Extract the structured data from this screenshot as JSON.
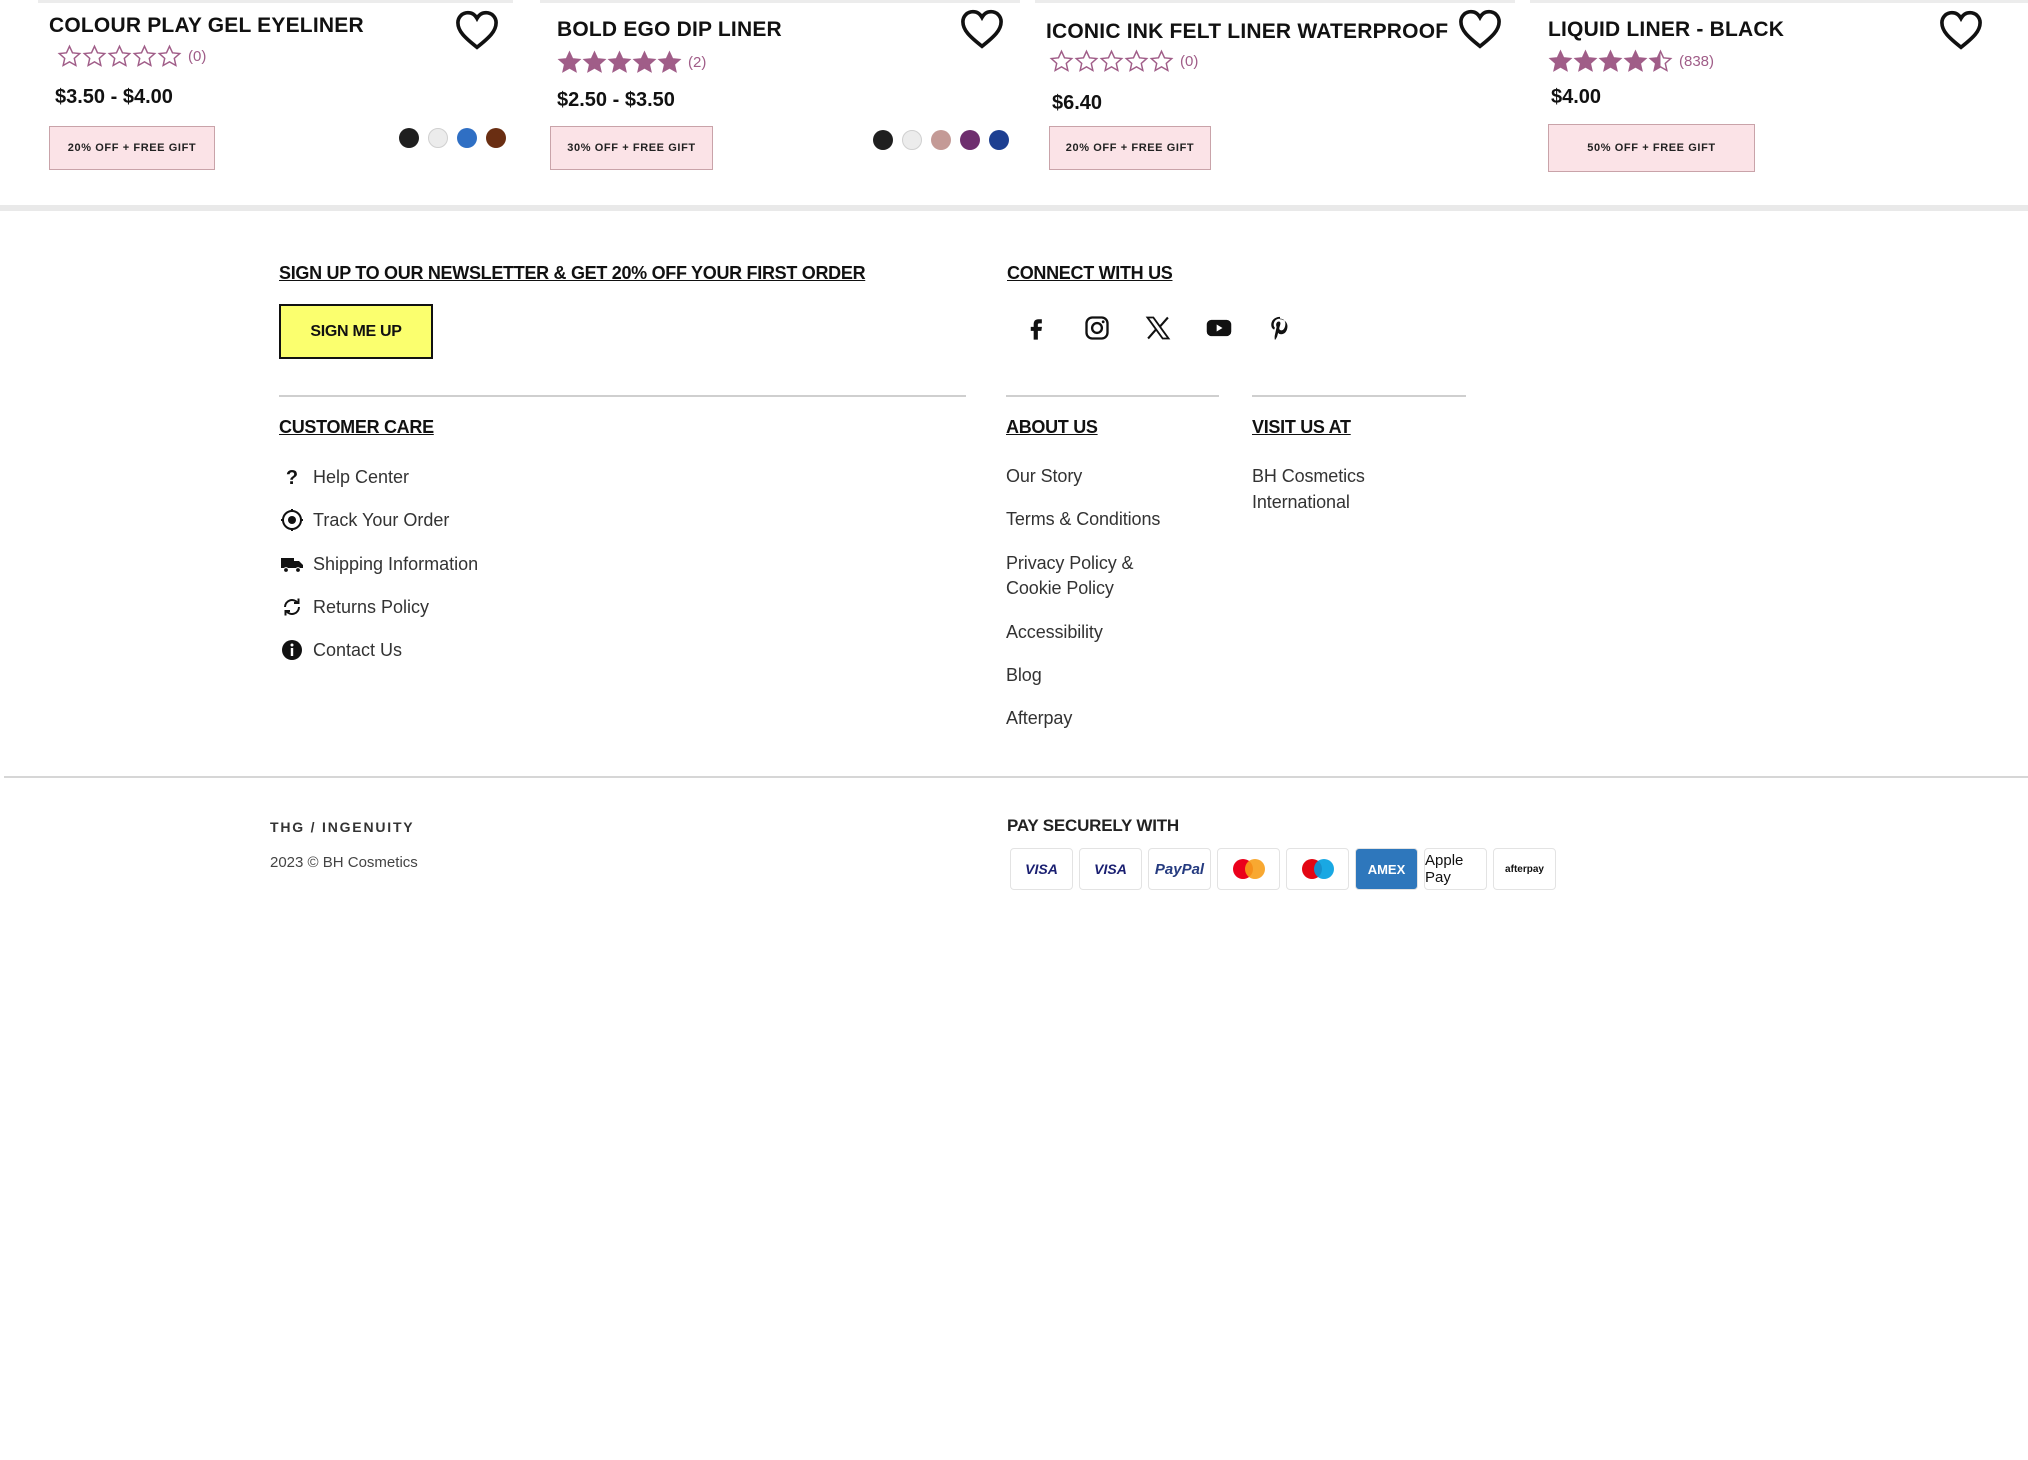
{
  "products": [
    {
      "name": "COLOUR PLAY GEL EYELINER",
      "rating": 0,
      "rating_count": "(0)",
      "price": "$3.50 - $4.00",
      "promo": "20% OFF + FREE GIFT",
      "swatches": [
        "#1f1f1f",
        "#ececec",
        "#2f6fc4",
        "#6a2e12"
      ]
    },
    {
      "name": "BOLD EGO DIP LINER",
      "rating": 5,
      "rating_count": "(2)",
      "price": "$2.50 - $3.50",
      "promo": "30% OFF + FREE GIFT",
      "swatches": [
        "#1f1f1f",
        "#ececec",
        "#c49a96",
        "#6e2e6e",
        "#1d3f91"
      ]
    },
    {
      "name": "ICONIC  INK FELT LINER WATERPROOF",
      "rating": 0,
      "rating_count": "(0)",
      "price": "$6.40",
      "promo": "20% OFF + FREE GIFT",
      "swatches": []
    },
    {
      "name": "LIQUID LINER  - BLACK",
      "rating": 4.5,
      "rating_count": "(838)",
      "price": "$4.00",
      "promo": "50% OFF + FREE GIFT",
      "swatches": []
    }
  ],
  "colors": {
    "star": "#a05d88",
    "promo_bg": "#fbe3e7",
    "signup_bg": "#fbff6e"
  },
  "newsletter": {
    "heading": "SIGN UP TO OUR NEWSLETTER & GET 20% OFF YOUR FIRST ORDER",
    "button": "SIGN ME UP"
  },
  "connect": {
    "heading": "CONNECT WITH US",
    "icons": [
      "facebook-icon",
      "instagram-icon",
      "x-icon",
      "youtube-icon",
      "pinterest-icon"
    ]
  },
  "customer_care": {
    "heading": "CUSTOMER CARE",
    "items": [
      {
        "label": "Help Center",
        "icon": "question-icon"
      },
      {
        "label": "Track Your Order",
        "icon": "target-icon"
      },
      {
        "label": "Shipping Information",
        "icon": "truck-icon"
      },
      {
        "label": "Returns Policy",
        "icon": "refresh-icon"
      },
      {
        "label": "Contact Us",
        "icon": "info-icon"
      }
    ]
  },
  "about": {
    "heading": "ABOUT US",
    "items": [
      "Our Story",
      "Terms & Conditions",
      "Privacy Policy &",
      "Cookie Policy",
      "Accessibility",
      "Blog",
      "Afterpay"
    ]
  },
  "visit": {
    "heading": "VISIT US AT",
    "line1": "BH Cosmetics",
    "line2": "International"
  },
  "bottom": {
    "logo": "THG / INGENUITY",
    "copyright": "2023 © BH Cosmetics",
    "pay_heading": "PAY SECURELY WITH",
    "payments": [
      "VISA",
      "VISA",
      "PayPal",
      "mastercard",
      "maestro",
      "AMEX",
      "Apple Pay",
      "afterpay"
    ]
  }
}
